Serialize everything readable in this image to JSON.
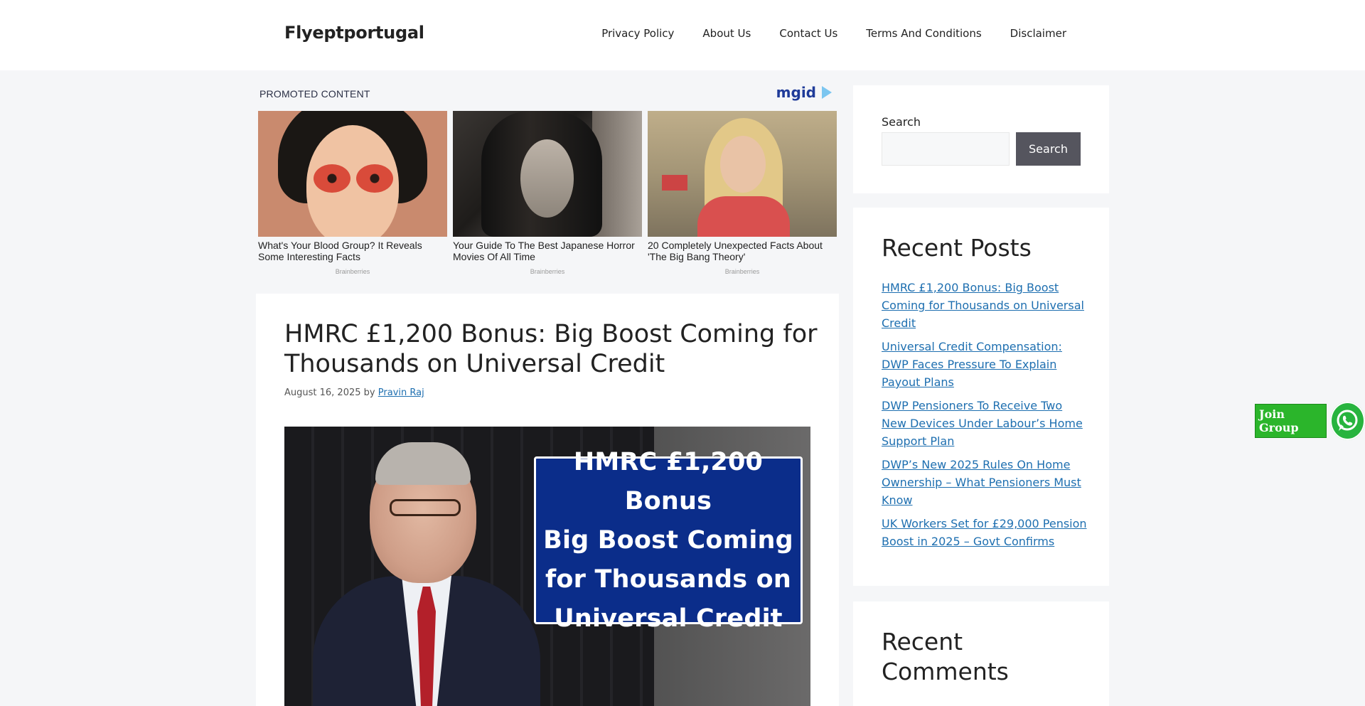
{
  "header": {
    "site_title": "Flyeptportugal",
    "nav": [
      "Privacy Policy",
      "About Us",
      "Contact Us",
      "Terms And Conditions",
      "Disclaimer"
    ]
  },
  "promo": {
    "label": "PROMOTED CONTENT",
    "logo_text": "mgid",
    "cards": [
      {
        "title": "What's Your Blood Group? It Reveals Some Interesting Facts",
        "source": "Brainberries"
      },
      {
        "title": "Your Guide To The Best Japanese Horror Movies Of All Time",
        "source": "Brainberries"
      },
      {
        "title": "20 Completely Unexpected Facts About 'The Big Bang Theory'",
        "source": "Brainberries"
      }
    ]
  },
  "article": {
    "title": "HMRC £1,200 Bonus: Big Boost Coming for Thousands on Universal Credit",
    "date": "August 16, 2025",
    "by": "by",
    "author": "Pravin Raj",
    "hero_text": "HMRC £1,200 Bonus\nBig Boost Coming\nfor Thousands on\nUniversal Credit"
  },
  "sidebar": {
    "search_label": "Search",
    "search_button": "Search",
    "search_value": "",
    "recent_posts_title": "Recent Posts",
    "recent_posts": [
      "HMRC £1,200 Bonus: Big Boost Coming for Thousands on Universal Credit",
      "Universal Credit Compensation: DWP Faces Pressure To Explain Payout Plans",
      "DWP Pensioners To Receive Two New Devices Under Labour’s Home Support Plan",
      "DWP’s New 2025 Rules On Home Ownership – What Pensioners Must Know",
      "UK Workers Set for £29,000 Pension Boost in 2025 – Govt Confirms"
    ],
    "recent_comments_title": "Recent Comments"
  },
  "floating": {
    "join_label": "Join Group",
    "icon": "whatsapp-icon"
  },
  "colors": {
    "link": "#1e6fb0",
    "search_button_bg": "#55555e",
    "hero_box_bg": "#0b2d8a",
    "join_green": "#2bb52b"
  }
}
